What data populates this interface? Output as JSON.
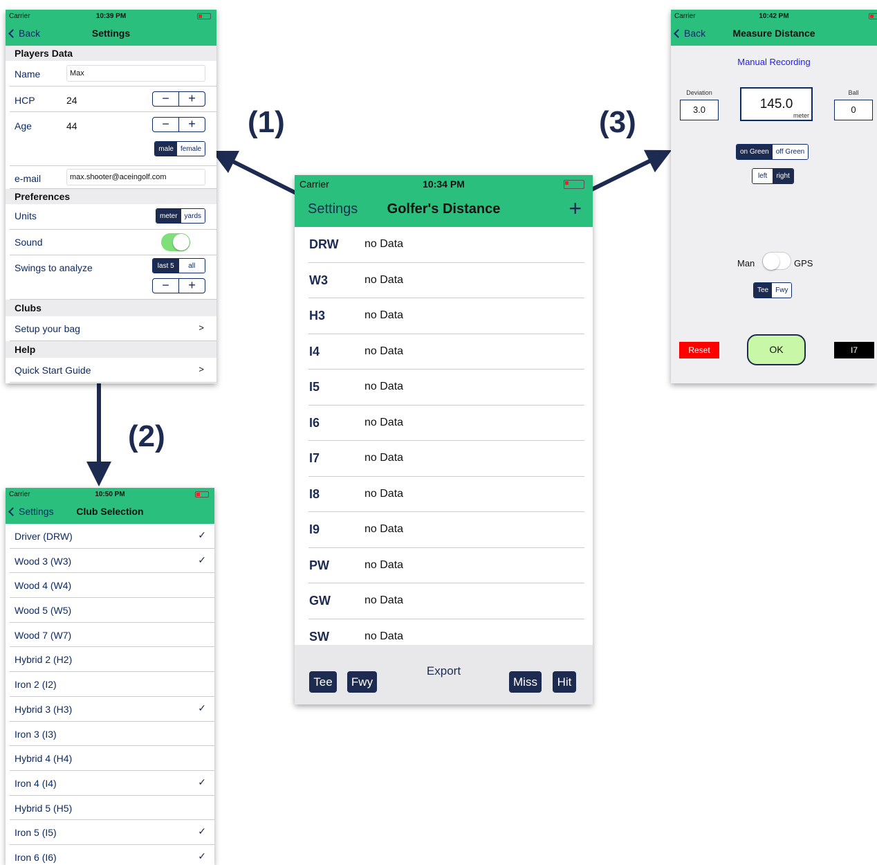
{
  "annotations": {
    "one": "(1)",
    "two": "(2)",
    "three": "(3)"
  },
  "main": {
    "status": {
      "carrier": "Carrier",
      "time": "10:34 PM"
    },
    "nav": {
      "left": "Settings",
      "title": "Golfer's Distance",
      "add": "+"
    },
    "clubs": [
      {
        "code": "DRW",
        "data": "no Data"
      },
      {
        "code": "W3",
        "data": "no Data"
      },
      {
        "code": "H3",
        "data": "no Data"
      },
      {
        "code": "I4",
        "data": "no Data"
      },
      {
        "code": "I5",
        "data": "no Data"
      },
      {
        "code": "I6",
        "data": "no Data"
      },
      {
        "code": "I7",
        "data": "no Data"
      },
      {
        "code": "I8",
        "data": "no Data"
      },
      {
        "code": "I9",
        "data": "no Data"
      },
      {
        "code": "PW",
        "data": "no Data"
      },
      {
        "code": "GW",
        "data": "no Data"
      },
      {
        "code": "SW",
        "data": "no Data"
      }
    ],
    "toolbar": {
      "tee": "Tee",
      "fwy": "Fwy",
      "export": "Export",
      "miss": "Miss",
      "hit": "Hit"
    }
  },
  "settings": {
    "status": {
      "carrier": "Carrier",
      "time": "10:39 PM"
    },
    "nav": {
      "back": "Back",
      "title": "Settings"
    },
    "players_header": "Players Data",
    "name_label": "Name",
    "name_value": "Max",
    "hcp_label": "HCP",
    "hcp_value": "24",
    "age_label": "Age",
    "age_value": "44",
    "gender": {
      "male": "male",
      "female": "female"
    },
    "email_label": "e-mail",
    "email_value": "max.shooter@aceingolf.com",
    "prefs_header": "Preferences",
    "units_label": "Units",
    "units": {
      "meter": "meter",
      "yards": "yards"
    },
    "sound_label": "Sound",
    "swings_label": "Swings to analyze",
    "swings": {
      "last5": "last 5",
      "all": "all"
    },
    "clubs_header": "Clubs",
    "setup_bag": "Setup your bag",
    "help_header": "Help",
    "quick_start": "Quick Start Guide",
    "chevron": ">",
    "minus": "−",
    "plus": "+"
  },
  "club_selection": {
    "status": {
      "carrier": "Carrier",
      "time": "10:50 PM"
    },
    "nav": {
      "back": "Settings",
      "title": "Club Selection"
    },
    "items": [
      {
        "name": "Driver (DRW)",
        "check": "✓"
      },
      {
        "name": "Wood 3 (W3)",
        "check": "✓"
      },
      {
        "name": "Wood 4 (W4)",
        "check": ""
      },
      {
        "name": "Wood 5 (W5)",
        "check": ""
      },
      {
        "name": "Wood 7 (W7)",
        "check": ""
      },
      {
        "name": "Hybrid 2 (H2)",
        "check": ""
      },
      {
        "name": "Iron 2 (I2)",
        "check": ""
      },
      {
        "name": "Hybrid 3 (H3)",
        "check": "✓"
      },
      {
        "name": "Iron 3 (I3)",
        "check": ""
      },
      {
        "name": "Hybrid 4 (H4)",
        "check": ""
      },
      {
        "name": "Iron 4 (I4)",
        "check": "✓"
      },
      {
        "name": "Hybrid 5 (H5)",
        "check": ""
      },
      {
        "name": "Iron 5 (I5)",
        "check": "✓"
      },
      {
        "name": "Iron 6 (I6)",
        "check": "✓"
      }
    ]
  },
  "measure": {
    "status": {
      "carrier": "Carrier",
      "time": "10:42 PM"
    },
    "nav": {
      "back": "Back",
      "title": "Measure Distance"
    },
    "mode": "Manual Recording",
    "deviation_label": "Deviation",
    "deviation_value": "3.0",
    "distance_value": "145.0",
    "distance_unit": "meter",
    "ball_label": "Ball",
    "ball_value": "0",
    "green": {
      "on": "on Green",
      "off": "off Green"
    },
    "side": {
      "left": "left",
      "right": "right"
    },
    "man_label": "Man",
    "gps_label": "GPS",
    "lie": {
      "tee": "Tee",
      "fwy": "Fwy"
    },
    "reset": "Reset",
    "ok": "OK",
    "club": "I7"
  },
  "colors": {
    "accent": "#2bbf7e",
    "navy": "#1d2b50",
    "reset": "#ff0000",
    "ok": "#c8f7a8"
  }
}
